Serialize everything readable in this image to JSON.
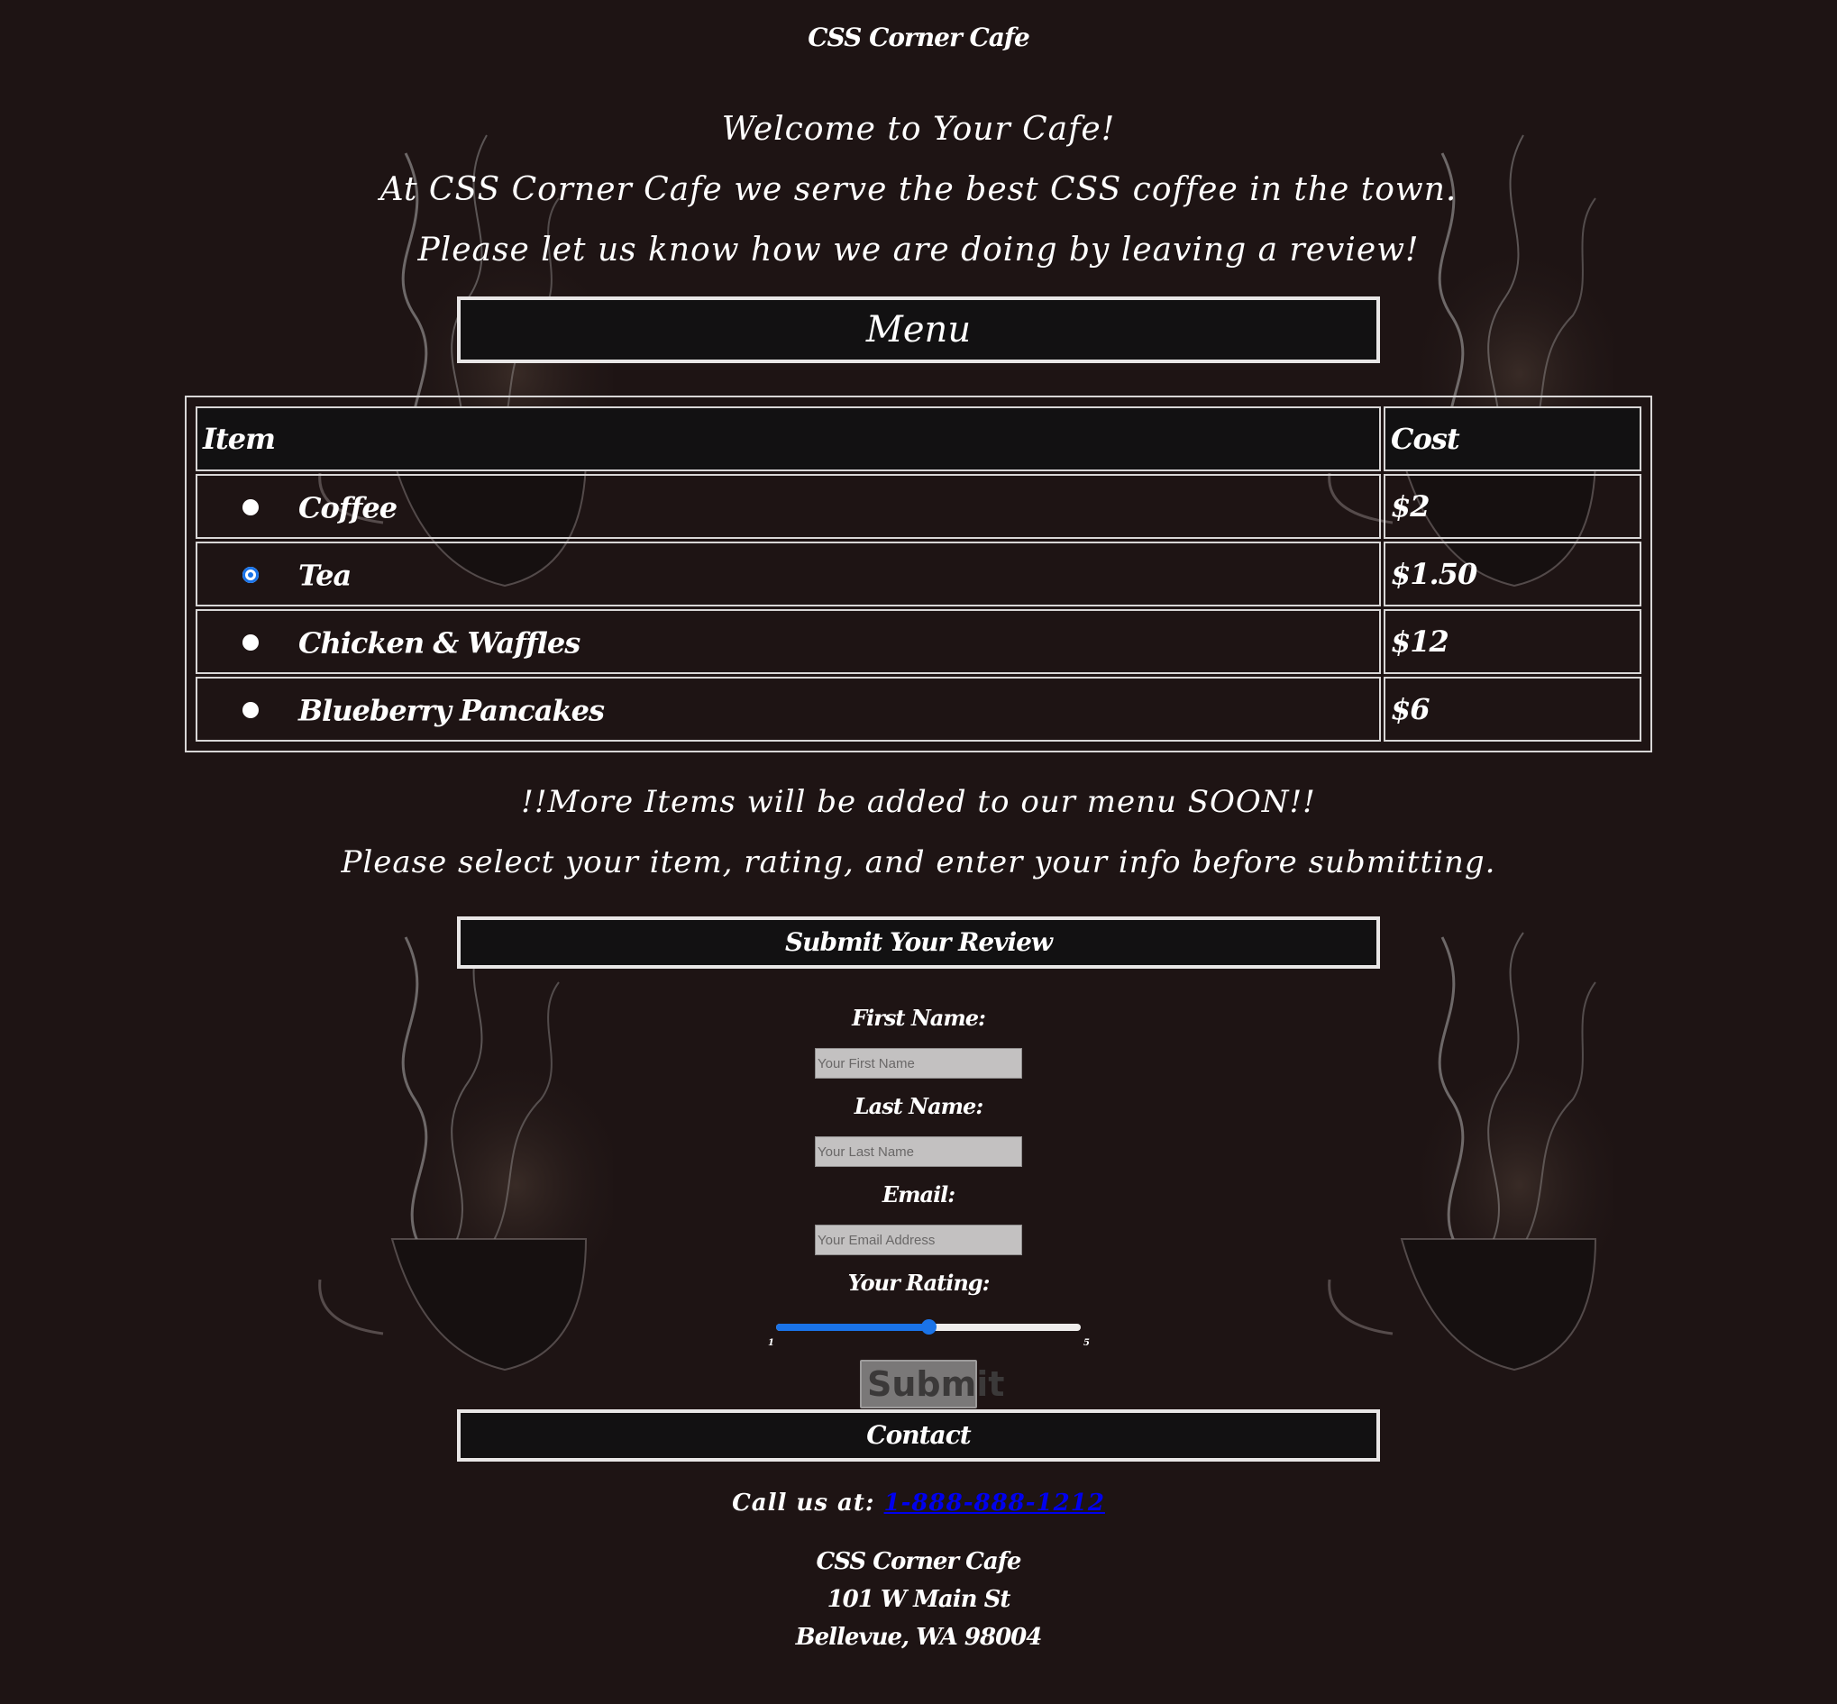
{
  "site_title": "CSS Corner Cafe",
  "intro": {
    "welcome": "Welcome to Your Cafe!",
    "tagline": "At CSS Corner Cafe we serve the best CSS coffee in the town.",
    "prompt": "Please let us know how we are doing by leaving a review!"
  },
  "menu": {
    "heading": "Menu",
    "columns": {
      "item": "Item",
      "cost": "Cost"
    },
    "items": [
      {
        "name": "Coffee",
        "cost": "$2",
        "selected": false
      },
      {
        "name": "Tea",
        "cost": "$1.50",
        "selected": true
      },
      {
        "name": "Chicken & Waffles",
        "cost": "$12",
        "selected": false
      },
      {
        "name": "Blueberry Pancakes",
        "cost": "$6",
        "selected": false
      }
    ]
  },
  "notice": {
    "more_items": "!!More Items will be added to our menu SOON!!",
    "instructions": "Please select your item, rating, and enter your info before submitting."
  },
  "review_form": {
    "heading": "Submit Your Review",
    "first_name": {
      "label": "First Name:",
      "placeholder": "Your First Name"
    },
    "last_name": {
      "label": "Last Name:",
      "placeholder": "Your Last Name"
    },
    "email": {
      "label": "Email:",
      "placeholder": "Your Email Address"
    },
    "rating": {
      "label": "Your Rating:",
      "min": "1",
      "max": "5",
      "value": 3
    },
    "submit_label": "Submit"
  },
  "contact": {
    "heading": "Contact",
    "call_prefix": "Call us at:",
    "phone": "1-888-888-1212",
    "address_name": "CSS Corner Cafe",
    "address_street": "101 W Main St",
    "address_city": "Bellevue, WA 98004"
  },
  "colors": {
    "background": "#1e1414",
    "bar_background": "#121112",
    "accent": "#1a73e8",
    "link": "#0000ee"
  },
  "icons": {
    "decor": "steaming-coffee-cup-icon"
  }
}
